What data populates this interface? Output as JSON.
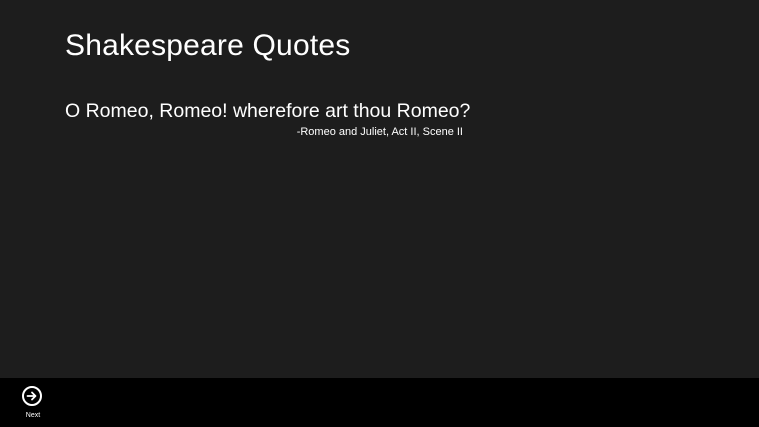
{
  "page": {
    "title": "Shakespeare Quotes"
  },
  "quote": {
    "text": "O Romeo, Romeo! wherefore art thou Romeo?",
    "source": "-Romeo and Juliet, Act II, Scene II"
  },
  "app_bar": {
    "buttons": [
      {
        "label": "Next",
        "icon": "arrow-right-circle-icon"
      }
    ]
  },
  "colors": {
    "background": "#1d1d1d",
    "app_bar": "#000000",
    "text": "#ffffff"
  }
}
